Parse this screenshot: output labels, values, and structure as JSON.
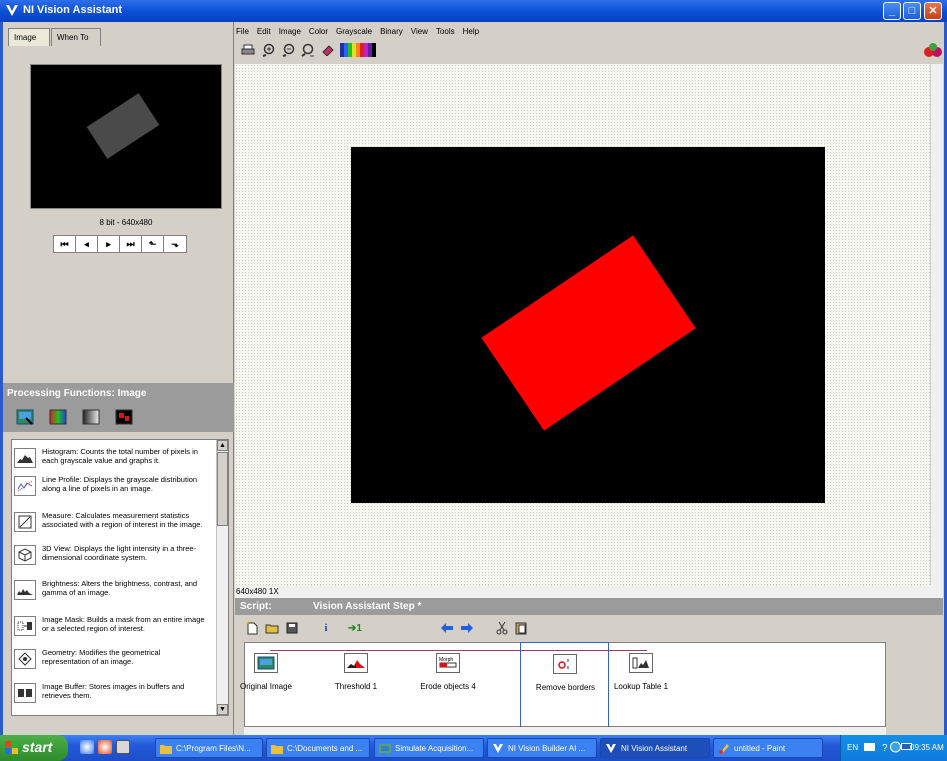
{
  "window": {
    "title": "NI Vision Assistant"
  },
  "left_tabs": [
    {
      "label": "Image"
    },
    {
      "label": "When To"
    }
  ],
  "image_info": "8 bit - 640x480",
  "nav_buttons": [
    "⏮",
    "◂",
    "▸",
    "⏭",
    "⬑",
    "⬎"
  ],
  "processing": {
    "header": "Processing Functions: Image",
    "functions": [
      {
        "text": "Histogram:  Counts the total number of pixels in each grayscale value and graphs it.",
        "icon": "histogram-icon"
      },
      {
        "text": "Line Profile:  Displays the grayscale distribution along a line of pixels in an image.",
        "icon": "line-profile-icon"
      },
      {
        "text": "Measure:  Calculates measurement statistics associated with a region of interest in the image.",
        "icon": "measure-icon"
      },
      {
        "text": "3D View:  Displays the light intensity in a three-dimensional coordinate system.",
        "icon": "3d-view-icon"
      },
      {
        "text": "Brightness:  Alters the brightness, contrast, and gamma of an image.",
        "icon": "brightness-icon"
      },
      {
        "text": "Image Mask:  Builds a mask from an entire image or a selected region of interest.",
        "icon": "image-mask-icon"
      },
      {
        "text": "Geometry:  Modifies the geometrical representation of an image.",
        "icon": "geometry-icon"
      },
      {
        "text": "Image Buffer:  Stores images in buffers and retrieves them.",
        "icon": "image-buffer-icon"
      }
    ]
  },
  "menu": [
    "File",
    "Edit",
    "Image",
    "Color",
    "Grayscale",
    "Binary",
    "View",
    "Tools",
    "Help"
  ],
  "status": {
    "zoom": "640x480 1X"
  },
  "script": {
    "label": "Script:",
    "step_title": "Vision Assistant Step *",
    "toolbar_ops": {
      "info": "i",
      "run_once": "➔1"
    },
    "steps": [
      {
        "label": "Original Image"
      },
      {
        "label": "Threshold 1"
      },
      {
        "label": "Erode objects 4"
      },
      {
        "label": "Remove borders"
      },
      {
        "label": "Lookup Table 1"
      }
    ]
  },
  "taskbar": {
    "start": "start",
    "tasks": [
      {
        "label": "C:\\Program Files\\N..."
      },
      {
        "label": "C:\\Documents and ..."
      },
      {
        "label": "Simulate Acquisition..."
      },
      {
        "label": "NI Vision Builder AI ..."
      },
      {
        "label": "NI Vision Assistant"
      },
      {
        "label": "untitled - Paint"
      }
    ],
    "lang": "EN",
    "clock": "09:35 AM"
  },
  "colors": {
    "titlebar": "#0a4fd6",
    "object": "#ff0000",
    "header_gray": "#9b9b9b"
  }
}
